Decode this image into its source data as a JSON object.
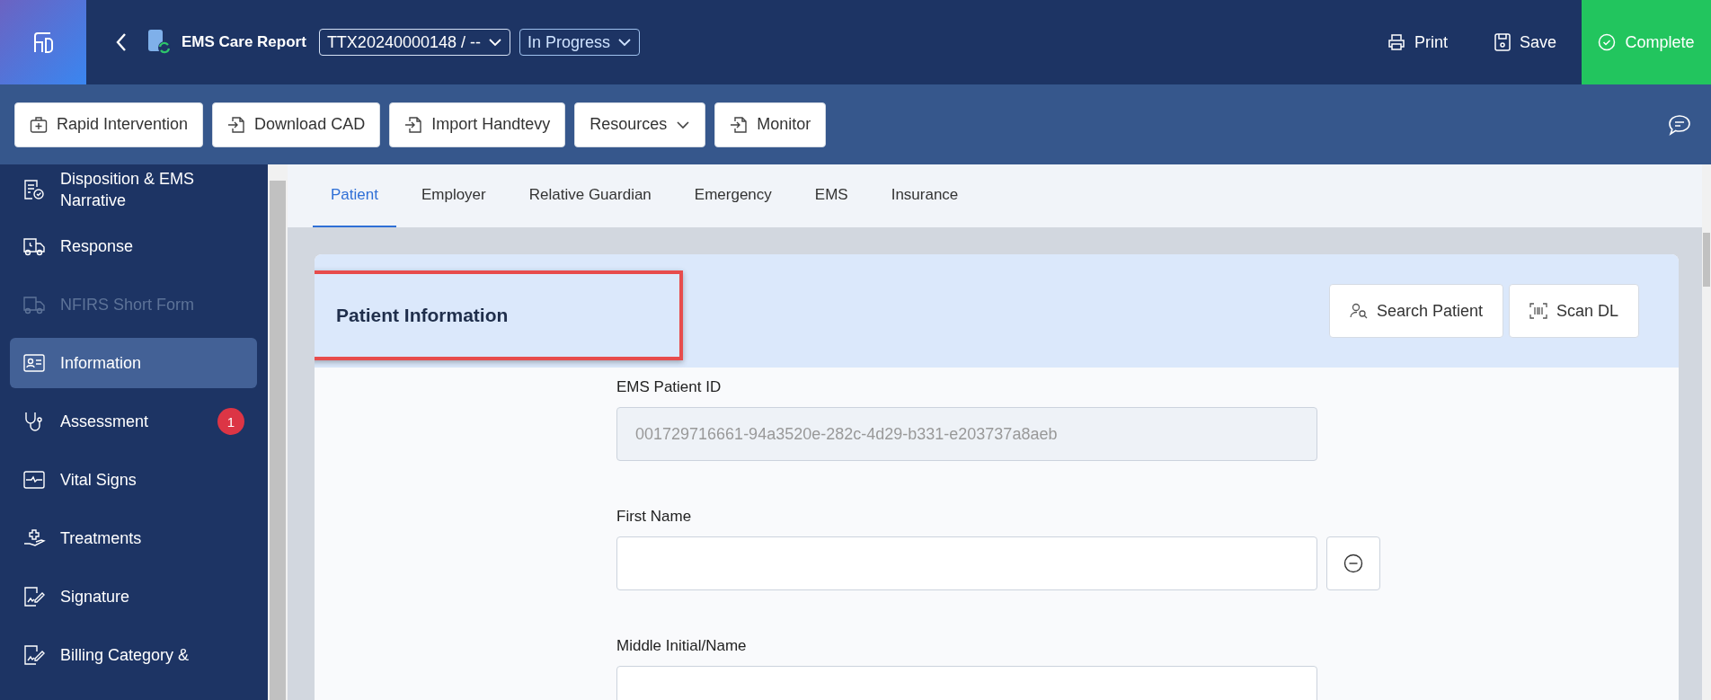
{
  "header": {
    "title": "EMS Care Report",
    "report_number": "TTX20240000148 / --",
    "status": "In Progress",
    "actions": [
      {
        "label": "Print",
        "kind": "plain"
      },
      {
        "label": "Save",
        "kind": "plain"
      },
      {
        "label": "Complete",
        "kind": "primary"
      }
    ]
  },
  "toolbar": [
    {
      "label": "Rapid Intervention",
      "has_caret": false
    },
    {
      "label": "Download CAD",
      "has_caret": false
    },
    {
      "label": "Import Handtevy",
      "has_caret": false
    },
    {
      "label": "Resources",
      "has_caret": true
    },
    {
      "label": "Monitor",
      "has_caret": false
    }
  ],
  "sidebar": {
    "items": [
      {
        "label": "Disposition & EMS Narrative",
        "selected": false,
        "disabled": false
      },
      {
        "label": "Response",
        "selected": false,
        "disabled": false
      },
      {
        "label": "NFIRS Short Form",
        "selected": false,
        "disabled": true
      },
      {
        "label": "Information",
        "selected": true,
        "disabled": false
      },
      {
        "label": "Assessment",
        "selected": false,
        "disabled": false,
        "badge": "1"
      },
      {
        "label": "Vital Signs",
        "selected": false,
        "disabled": false
      },
      {
        "label": "Treatments",
        "selected": false,
        "disabled": false
      },
      {
        "label": "Signature",
        "selected": false,
        "disabled": false
      },
      {
        "label": "Billing Category &",
        "selected": false,
        "disabled": false
      }
    ]
  },
  "tabs": [
    {
      "label": "Patient",
      "selected": true
    },
    {
      "label": "Employer",
      "selected": false
    },
    {
      "label": "Relative Guardian",
      "selected": false
    },
    {
      "label": "Emergency",
      "selected": false
    },
    {
      "label": "EMS",
      "selected": false
    },
    {
      "label": "Insurance",
      "selected": false
    }
  ],
  "card": {
    "title": "Patient Information",
    "highlighted": true,
    "buttons": [
      "Search Patient",
      "Scan DL"
    ],
    "fields": [
      {
        "label": "EMS Patient ID",
        "value": "001729716661-94a3520e-282c-4d29-b331-e203737a8aeb",
        "disabled": true,
        "removable": false
      },
      {
        "label": "First Name",
        "disabled": false,
        "removable": true
      },
      {
        "label": "Middle Initial/Name",
        "disabled": false,
        "removable": false
      }
    ]
  }
}
